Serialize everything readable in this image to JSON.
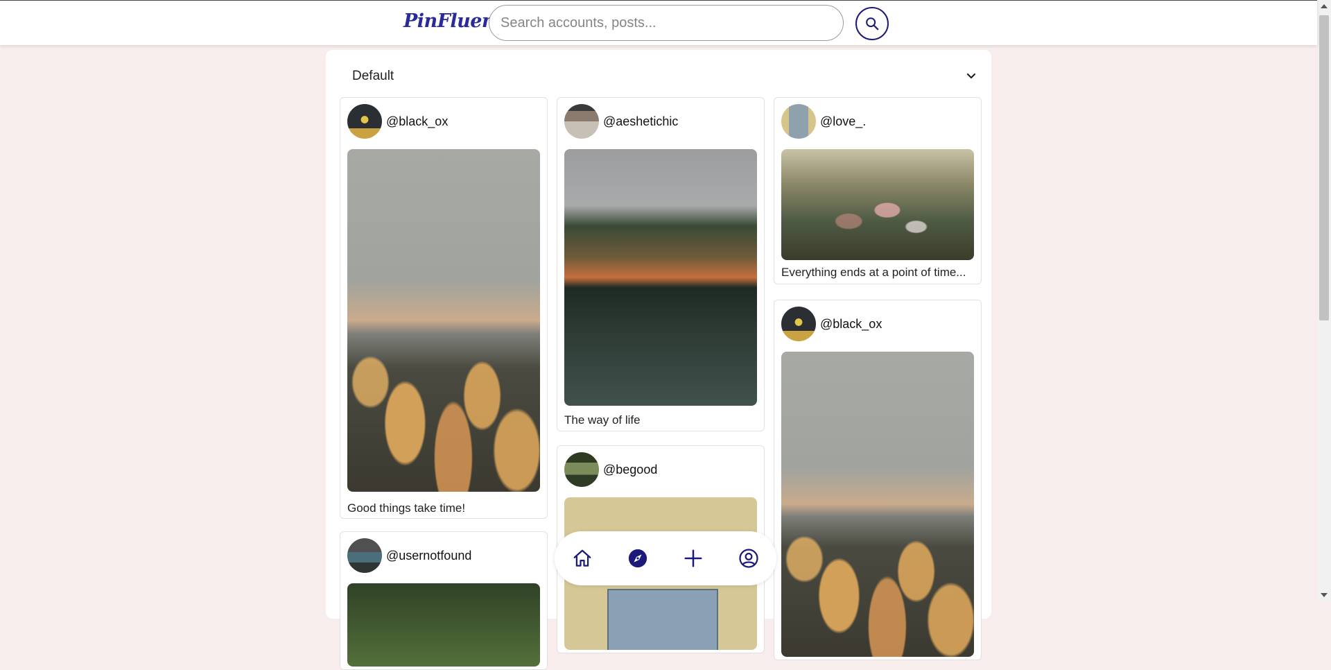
{
  "app": {
    "logo_text": "PinFluence"
  },
  "search": {
    "placeholder": "Search accounts, posts..."
  },
  "sort": {
    "selected": "Default"
  },
  "posts": [
    {
      "username": "@black_ox",
      "caption": "Good things take time!",
      "avatar_icon": "avatar-black-ox",
      "image": "flower-field-photo"
    },
    {
      "username": "@usernotfound",
      "caption": "",
      "avatar_icon": "avatar-usernotfound",
      "image": "forest-photo"
    },
    {
      "username": "@aeshetichic",
      "caption": "The way of life",
      "avatar_icon": "avatar-aeshetichic",
      "image": "lake-forest-photo"
    },
    {
      "username": "@begood",
      "caption": "",
      "avatar_icon": "avatar-begood",
      "image": "photo"
    },
    {
      "username": "@love_.",
      "caption": "Everything ends at a point of time...",
      "avatar_icon": "avatar-love",
      "image": "wildflower-photo"
    },
    {
      "username": "@black_ox",
      "caption": "",
      "avatar_icon": "avatar-black-ox",
      "image": "flower-field-photo"
    }
  ],
  "nav": {
    "items": [
      {
        "icon": "home-icon"
      },
      {
        "icon": "compass-icon"
      },
      {
        "icon": "plus-icon"
      },
      {
        "icon": "user-icon"
      }
    ]
  },
  "colors": {
    "accent": "#1b1a7a",
    "background": "#f8eded",
    "panel": "#ffffff"
  }
}
